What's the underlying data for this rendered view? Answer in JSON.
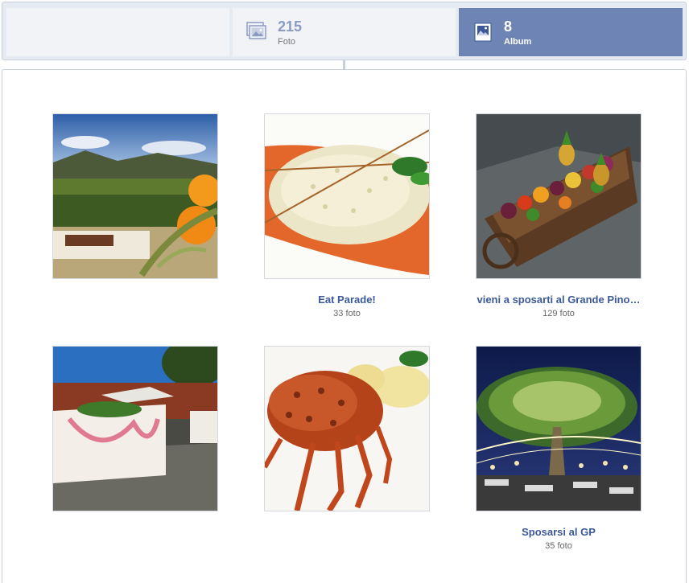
{
  "tabs": {
    "photos": {
      "count": "215",
      "label": "Foto",
      "icon": "photos-stack-icon"
    },
    "albums": {
      "count": "8",
      "label": "Album",
      "icon": "album-icon"
    }
  },
  "albums": [
    {
      "title": "",
      "count_label": ""
    },
    {
      "title": "Eat Parade!",
      "count_label": "33 foto"
    },
    {
      "title": "vieni a sposarti al Grande Pino…",
      "count_label": "129 foto"
    },
    {
      "title": "",
      "count_label": ""
    },
    {
      "title": "",
      "count_label": ""
    },
    {
      "title": "Sposarsi al GP",
      "count_label": "35 foto"
    }
  ],
  "colors": {
    "active_tab": "#6d84b4",
    "link": "#3b5998",
    "inactive_tab": "#f2f3f7",
    "border": "#c8cfdc"
  }
}
